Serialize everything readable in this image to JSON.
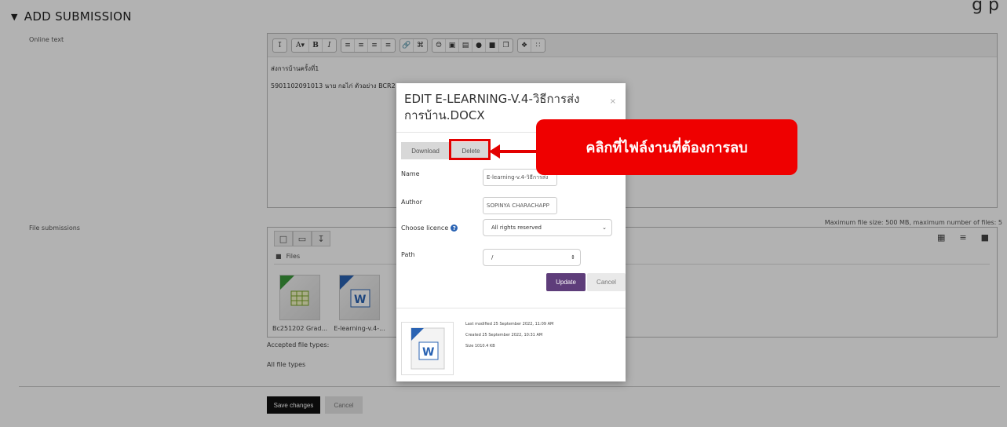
{
  "corner_text": "g p",
  "section": {
    "title": "ADD SUBMISSION"
  },
  "online_text": {
    "label": "Online text",
    "lines": [
      "ส่งการบ้านครั้งที่1",
      "5901102091013 นาย กอไก่ ตัวอย่าง BCR2"
    ]
  },
  "file_submissions": {
    "label": "File submissions",
    "max_size_text": "Maximum file size: 500 MB, maximum number of files: 5",
    "folder_label": "Files",
    "files": [
      {
        "name": "Bc251202 Grad...",
        "type": "spreadsheet"
      },
      {
        "name": "E-learning-v.4-...",
        "type": "word"
      }
    ],
    "accepted_label": "Accepted file types:",
    "accepted_value": "All file types"
  },
  "actions": {
    "save": "Save changes",
    "cancel": "Cancel"
  },
  "modal": {
    "title": "EDIT E-LEARNING-V.4-วิธีการส่งการบ้าน.DOCX",
    "close": "×",
    "download": "Download",
    "delete": "Delete",
    "name_label": "Name",
    "name_value": "E-learning-v.4-วิธีการส่ง",
    "author_label": "Author",
    "author_value": "SOPINYA CHARACHAPP",
    "licence_label": "Choose licence",
    "licence_value": "All rights reserved",
    "path_label": "Path",
    "path_value": "/",
    "update": "Update",
    "cancel": "Cancel",
    "last_modified": "Last modified  25 September 2022, 11:09 AM",
    "created": "Created  25 September 2022, 10:31 AM",
    "size": "Size  1010.4 KB"
  },
  "annotation": {
    "text": "คลิกที่ไฟล์งานที่ต้องการลบ"
  },
  "colors": {
    "annotation_red": "#ef0000",
    "update_purple": "#5e3d7a",
    "save_black": "#111111"
  }
}
